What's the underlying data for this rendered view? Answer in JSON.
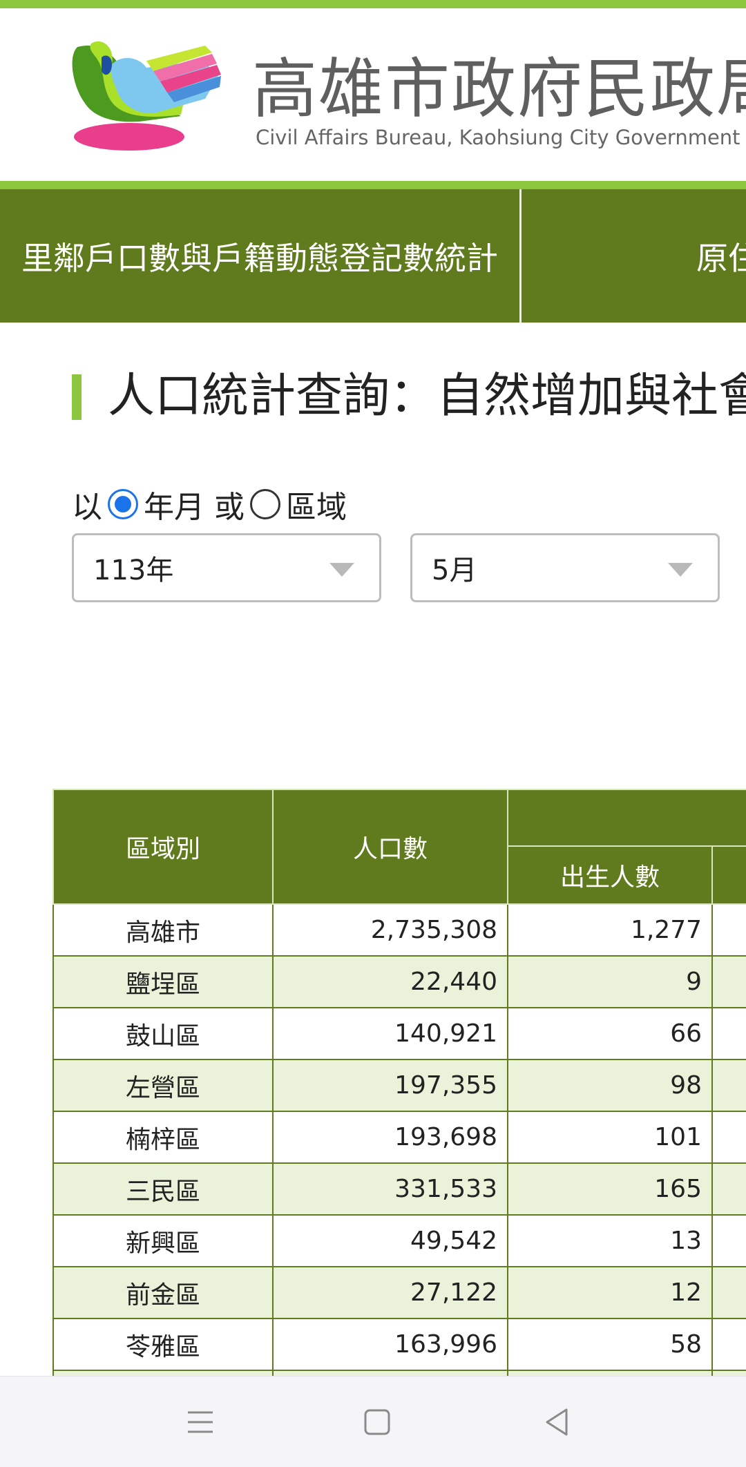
{
  "header": {
    "title": "高雄市政府民政局",
    "subtitle": "Civil Affairs Bureau, Kaohsiung City Government"
  },
  "nav": {
    "items": [
      {
        "label": "里鄰戶口數與戶籍動態登記數統計"
      },
      {
        "label": "原住"
      }
    ]
  },
  "page": {
    "title": "人口統計查詢：自然增加與社會"
  },
  "filter": {
    "prefix": "以",
    "option_yearmonth": "年月",
    "or": "或",
    "option_region": "區域",
    "selected": "yearmonth",
    "year": "113年",
    "month": "5月"
  },
  "table": {
    "headers": {
      "region": "區域別",
      "population": "人口數",
      "births": "出生人數"
    },
    "rows": [
      {
        "region": "高雄市",
        "population": "2,735,308",
        "births": "1,277"
      },
      {
        "region": "鹽埕區",
        "population": "22,440",
        "births": "9"
      },
      {
        "region": "鼓山區",
        "population": "140,921",
        "births": "66"
      },
      {
        "region": "左營區",
        "population": "197,355",
        "births": "98"
      },
      {
        "region": "楠梓區",
        "population": "193,698",
        "births": "101"
      },
      {
        "region": "三民區",
        "population": "331,533",
        "births": "165"
      },
      {
        "region": "新興區",
        "population": "49,542",
        "births": "13"
      },
      {
        "region": "前金區",
        "population": "27,122",
        "births": "12"
      },
      {
        "region": "苓雅區",
        "population": "163,996",
        "births": "58"
      }
    ]
  },
  "colors": {
    "nav_green": "#5f7b1e",
    "accent_green": "#8cc63f",
    "row_alt": "#eaf2d9",
    "radio_blue": "#1a73e8"
  }
}
